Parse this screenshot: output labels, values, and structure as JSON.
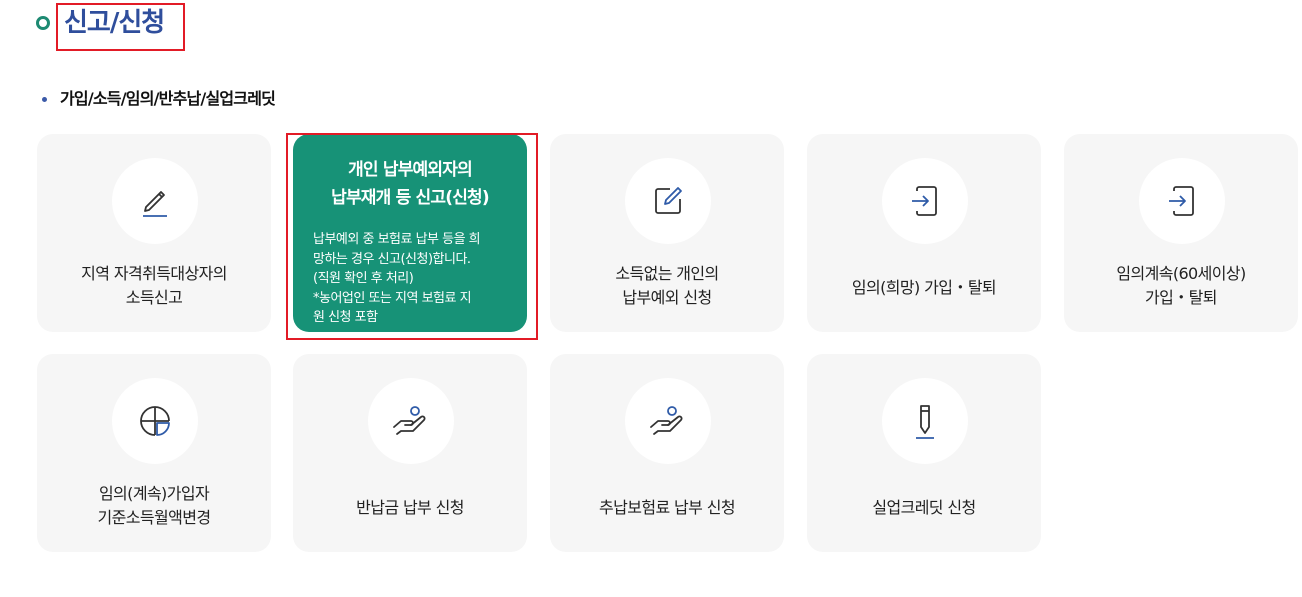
{
  "page": {
    "title": "신고/신청"
  },
  "section": {
    "heading": "가입/소득/임의/반추납/실업크레딧"
  },
  "cards": [
    {
      "label": "지역 자격취득대상자의\n소득신고",
      "icon": "pencil-underline-icon"
    },
    {
      "title": "개인 납부예외자의\n납부재개 등 신고(신청)",
      "description": "납부예외 중 보험료 납부 등을 희\n망하는 경우 신고(신청)합니다.\n(직원 확인 후 처리)\n*농어업인 또는 지역 보험료 지\n원 신청 포함",
      "state": "active"
    },
    {
      "label": "소득없는 개인의\n납부예외 신청",
      "icon": "edit-square-icon"
    },
    {
      "label": "임의(희망) 가입・탈퇴",
      "icon": "login-arrow-icon"
    },
    {
      "label": "임의계속(60세이상)\n가입・탈퇴",
      "icon": "login-arrow-icon"
    },
    {
      "label": "임의(계속)가입자\n기준소득월액변경",
      "icon": "pie-chart-icon"
    },
    {
      "label": "반납금 납부 신청",
      "icon": "hand-payment-icon"
    },
    {
      "label": "추납보험료 납부 신청",
      "icon": "hand-payment-icon"
    },
    {
      "label": "실업크레딧 신청",
      "icon": "pen-icon"
    }
  ],
  "colors": {
    "accent": "#179277",
    "title": "#2f4e9c",
    "highlight": "#e21b26",
    "card_bg": "#f6f6f6"
  }
}
